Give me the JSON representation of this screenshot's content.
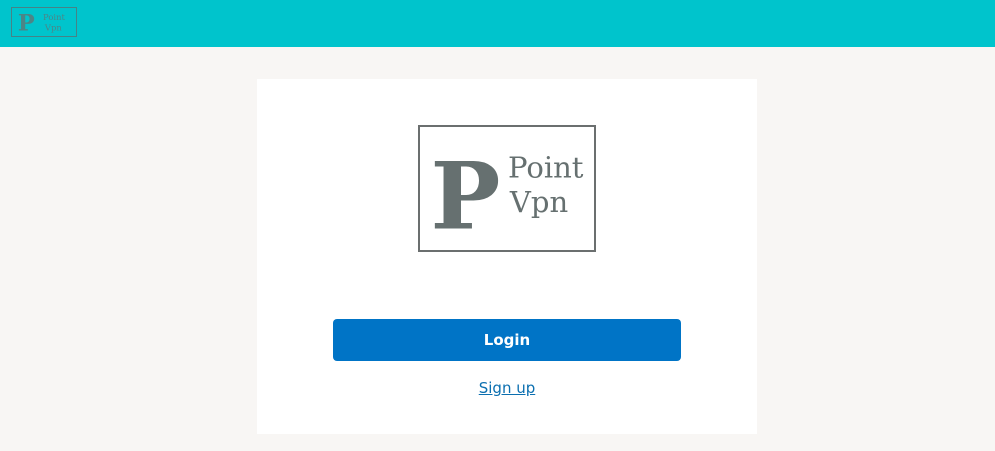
{
  "header": {
    "logo": {
      "icon": "point-vpn-logo",
      "letter": "P",
      "line1": "Point",
      "line2": "Vpn"
    }
  },
  "card": {
    "logo": {
      "icon": "point-vpn-logo",
      "letter": "P",
      "line1": "Point",
      "line2": "Vpn"
    },
    "login_label": "Login",
    "signup_label": "Sign up"
  },
  "colors": {
    "header_bg": "#00c4cc",
    "page_bg": "#f8f6f4",
    "card_bg": "#ffffff",
    "primary_button": "#0074c6",
    "link": "#0b6fb0",
    "logo_gray": "#667070"
  }
}
